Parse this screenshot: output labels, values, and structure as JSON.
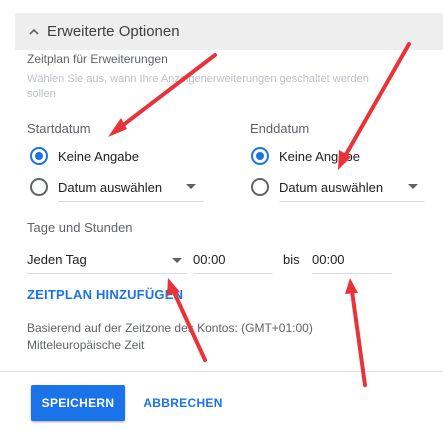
{
  "section": {
    "title": "Erweiterte Optionen"
  },
  "schedule": {
    "title": "Zeitplan für Erweiterungen",
    "description_line1": "Wählen Sie aus, wann Ihre Anzeigenerweiterungen geschaltet werden",
    "description_line2": "sollen"
  },
  "start": {
    "label": "Startdatum",
    "option_none": "Keine Angabe",
    "option_pick": "Datum auswählen"
  },
  "end": {
    "label": "Enddatum",
    "option_none": "Keine Angabe",
    "option_pick": "Datum auswählen"
  },
  "days": {
    "label": "Tage und Stunden",
    "day_value": "Jeden Tag",
    "from_time": "00:00",
    "bis": "bis",
    "to_time": "00:00"
  },
  "add_schedule": "ZEITPLAN HINZUFÜGEN",
  "timezone": {
    "line1": "Basierend auf der Zeitzone des Kontos: (GMT+01:00)",
    "line2": "Mitteleuropäische Zeit"
  },
  "actions": {
    "save": "SPEICHERN",
    "cancel": "ABBRECHEN"
  },
  "colors": {
    "accent": "#1a73e8",
    "annotation_arrow": "#e8333a"
  },
  "icons": {
    "section_toggle": "chevron-up-icon",
    "dropdown": "dropdown-arrow-icon"
  }
}
